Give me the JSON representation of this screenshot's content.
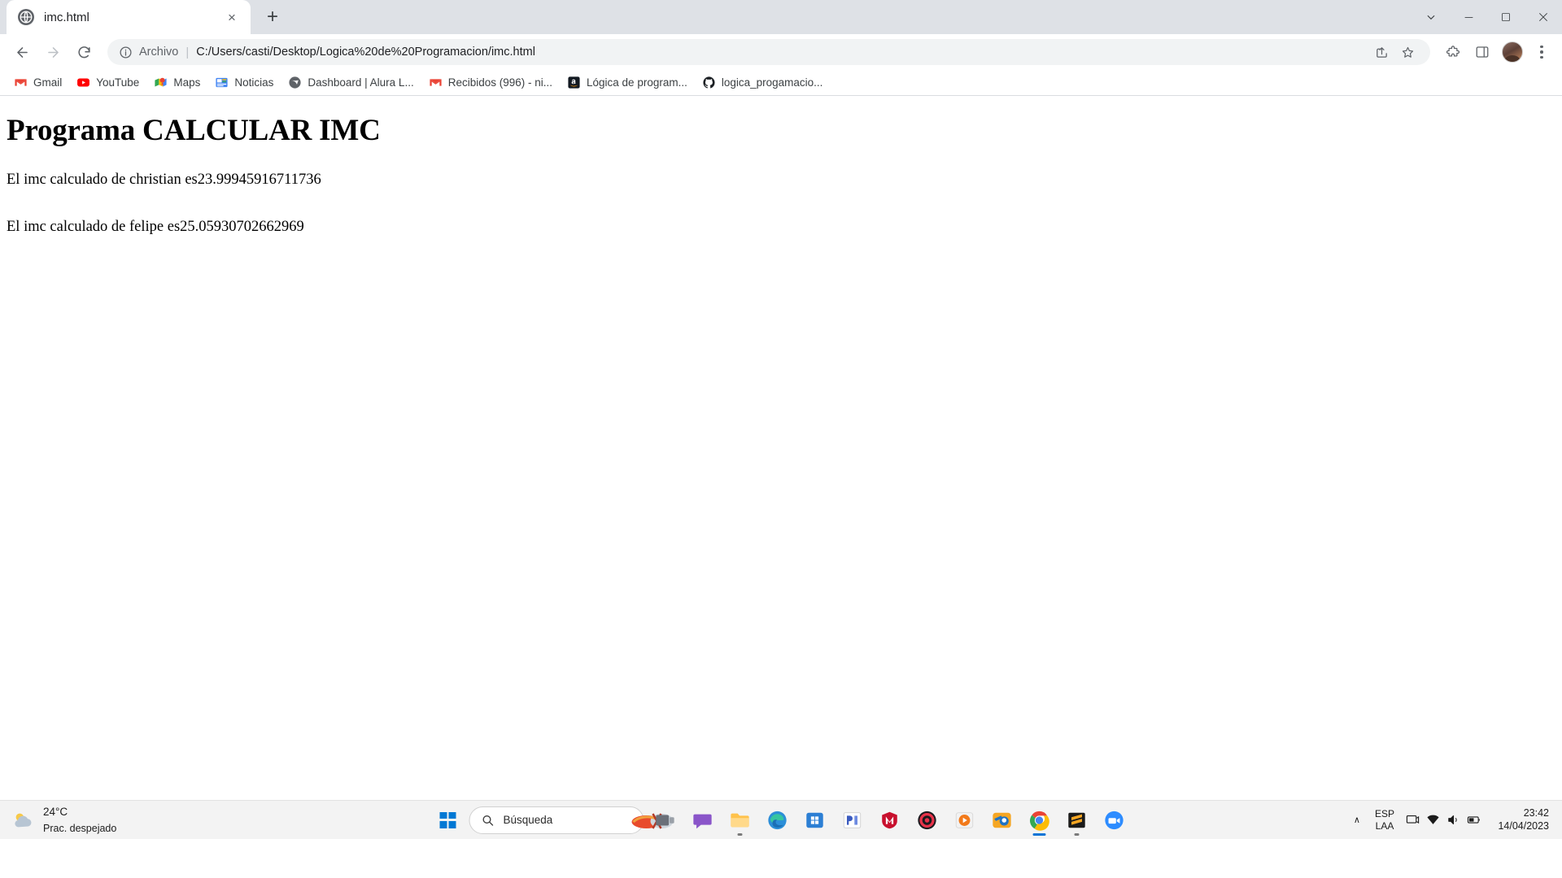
{
  "browser": {
    "tab": {
      "title": "imc.html",
      "favicon": "globe-icon",
      "close_label": "×"
    },
    "newtab_label": "+",
    "window_controls": {
      "search_tabs": "⌄",
      "minimize": "—",
      "maximize": "☐",
      "close": "✕"
    },
    "toolbar": {
      "back_label": "←",
      "forward_label": "→",
      "reload_label": "↻",
      "scheme_label": "Archivo",
      "separator": "|",
      "url": "C:/Users/casti/Desktop/Logica%20de%20Programacion/imc.html",
      "share_label": "share-icon",
      "bookmark_label": "star-icon",
      "extensions_label": "extensions-icon",
      "sidepanel_label": "side-panel-icon",
      "profile_label": "profile-avatar",
      "menu_label": "⋮"
    },
    "bookmarks": [
      {
        "label": "Gmail",
        "icon": "gmail-icon"
      },
      {
        "label": "YouTube",
        "icon": "youtube-icon"
      },
      {
        "label": "Maps",
        "icon": "maps-icon"
      },
      {
        "label": "Noticias",
        "icon": "news-icon"
      },
      {
        "label": "Dashboard | Alura L...",
        "icon": "alura-icon"
      },
      {
        "label": "Recibidos (996) - ni...",
        "icon": "gmail-icon"
      },
      {
        "label": "Lógica de program...",
        "icon": "amazon-icon"
      },
      {
        "label": "logica_progamacio...",
        "icon": "github-icon"
      }
    ]
  },
  "page": {
    "heading": "Programa CALCULAR IMC",
    "lines": [
      "El imc calculado de christian es23.99945916711736",
      "El imc calculado de felipe es25.05930702662969"
    ]
  },
  "taskbar": {
    "weather": {
      "temperature": "24°C",
      "description": "Prac. despejado",
      "icon": "cloud-sun-icon"
    },
    "start_label": "windows-start",
    "search": {
      "placeholder": "Búsqueda",
      "icon": "search-icon"
    },
    "apps": [
      {
        "name": "task-view",
        "icon": "task-view-icon"
      },
      {
        "name": "chat",
        "icon": "chat-icon"
      },
      {
        "name": "file-explorer",
        "icon": "folder-icon"
      },
      {
        "name": "edge",
        "icon": "edge-icon"
      },
      {
        "name": "microsoft-store",
        "icon": "store-icon"
      },
      {
        "name": "lightshot",
        "icon": "lightshot-icon"
      },
      {
        "name": "mcafee",
        "icon": "mcafee-icon"
      },
      {
        "name": "opera-gx",
        "icon": "opera-icon"
      },
      {
        "name": "media-player",
        "icon": "media-player-icon"
      },
      {
        "name": "blender",
        "icon": "blender-icon"
      },
      {
        "name": "google-chrome",
        "icon": "chrome-icon"
      },
      {
        "name": "sublime-text",
        "icon": "sublime-icon"
      },
      {
        "name": "zoom",
        "icon": "zoom-icon"
      }
    ],
    "tray": {
      "overflow_label": "∧",
      "language_primary": "ESP",
      "language_secondary": "LAA",
      "icons": [
        "notification-icon",
        "network-icon",
        "volume-icon",
        "battery-icon"
      ]
    },
    "clock": {
      "time": "23:42",
      "date": "14/04/2023"
    }
  }
}
